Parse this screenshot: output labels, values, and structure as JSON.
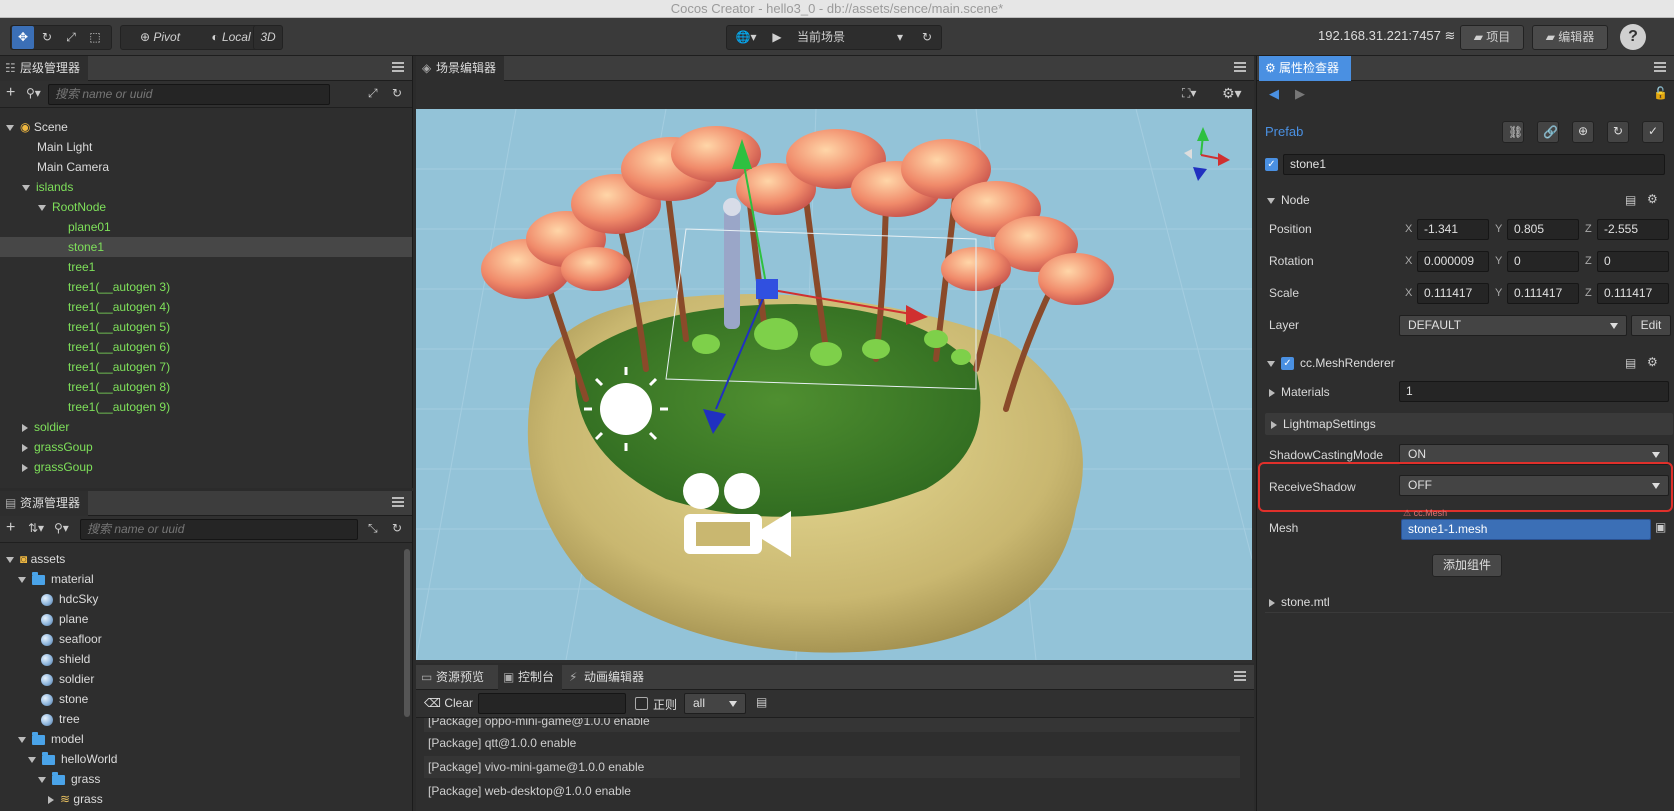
{
  "window": {
    "title": "Cocos Creator - hello3_0 - db://assets/sence/main.scene*"
  },
  "toolbar": {
    "pivot": "Pivot",
    "local": "Local",
    "mode3d": "3D",
    "scene_select": "当前场景",
    "ip": "192.168.31.221:7457",
    "project": "项目",
    "editor": "编辑器",
    "help": "?"
  },
  "hierarchy": {
    "title": "层级管理器",
    "search_placeholder": "搜索 name or uuid",
    "items": [
      {
        "label": "Scene"
      },
      {
        "label": "Main Light"
      },
      {
        "label": "Main Camera"
      },
      {
        "label": "islands"
      },
      {
        "label": "RootNode"
      },
      {
        "label": "plane01"
      },
      {
        "label": "stone1"
      },
      {
        "label": "tree1"
      },
      {
        "label": "tree1(__autogen 3)"
      },
      {
        "label": "tree1(__autogen 4)"
      },
      {
        "label": "tree1(__autogen 5)"
      },
      {
        "label": "tree1(__autogen 6)"
      },
      {
        "label": "tree1(__autogen 7)"
      },
      {
        "label": "tree1(__autogen 8)"
      },
      {
        "label": "tree1(__autogen 9)"
      },
      {
        "label": "soldier"
      },
      {
        "label": "grassGoup"
      },
      {
        "label": "grassGoup"
      }
    ]
  },
  "assets": {
    "title": "资源管理器",
    "search_placeholder": "搜索 name or uuid",
    "items": [
      {
        "label": "assets"
      },
      {
        "label": "material"
      },
      {
        "label": "hdcSky"
      },
      {
        "label": "plane"
      },
      {
        "label": "seafloor"
      },
      {
        "label": "shield"
      },
      {
        "label": "soldier"
      },
      {
        "label": "stone"
      },
      {
        "label": "tree"
      },
      {
        "label": "model"
      },
      {
        "label": "helloWorld"
      },
      {
        "label": "grass"
      },
      {
        "label": "grass"
      }
    ]
  },
  "scene_editor": {
    "title": "场景编辑器"
  },
  "console": {
    "tabs": [
      "资源预览",
      "控制台",
      "动画编辑器"
    ],
    "clear": "Clear",
    "regex": "正则",
    "level": "all",
    "lines": [
      "[Package] oppo-mini-game@1.0.0 enable",
      "[Package] qtt@1.0.0 enable",
      "[Package] vivo-mini-game@1.0.0 enable",
      "[Package] web-desktop@1.0.0 enable"
    ]
  },
  "inspector": {
    "title": "属性检查器",
    "prefab": "Prefab",
    "node_name": "stone1",
    "node_section": "Node",
    "position": {
      "label": "Position",
      "x": "-1.341",
      "y": "0.805",
      "z": "-2.555"
    },
    "rotation": {
      "label": "Rotation",
      "x": "0.000009",
      "y": "0",
      "z": "0"
    },
    "scale": {
      "label": "Scale",
      "x": "0.111417",
      "y": "0.111417",
      "z": "0.111417"
    },
    "layer": {
      "label": "Layer",
      "value": "DEFAULT",
      "edit": "Edit"
    },
    "axis_x": "X",
    "axis_y": "Y",
    "axis_z": "Z",
    "mesh_renderer": "cc.MeshRenderer",
    "materials": {
      "label": "Materials",
      "value": "1"
    },
    "lightmap": "LightmapSettings",
    "shadow_casting": {
      "label": "ShadowCastingMode",
      "value": "ON"
    },
    "receive_shadow": {
      "label": "ReceiveShadow",
      "value": "OFF"
    },
    "mesh_hint": "cc.Mesh",
    "mesh": {
      "label": "Mesh",
      "value": "stone1-1.mesh"
    },
    "add_component": "添加组件",
    "material_asset": "stone.mtl"
  },
  "colors": {
    "accent": "#4a90e2",
    "green_text": "#7ee05a",
    "highlight": "#e0302b"
  }
}
